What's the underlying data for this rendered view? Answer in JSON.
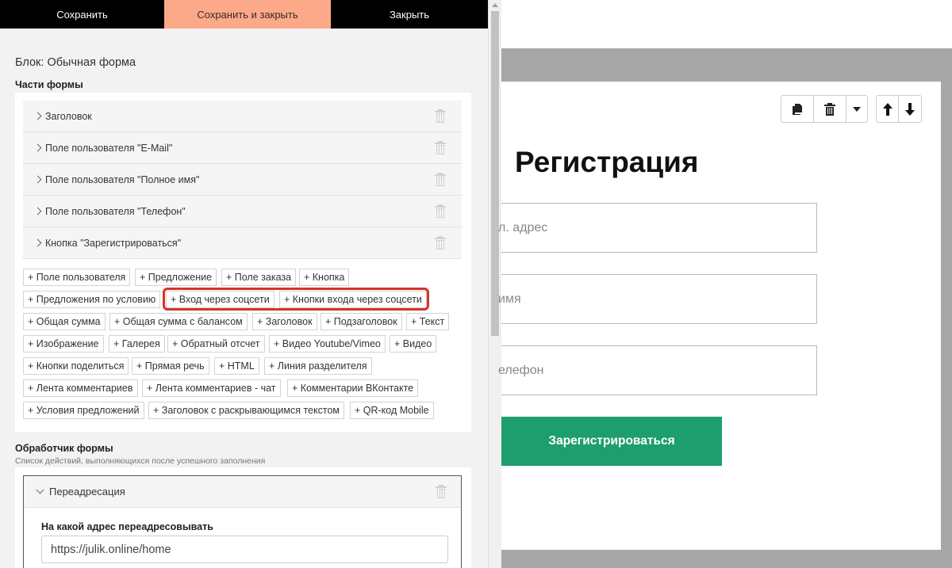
{
  "topbar": {
    "save": "Сохранить",
    "save_close": "Сохранить и закрыть",
    "close": "Закрыть"
  },
  "block_title": "Блок: Обычная форма",
  "parts": {
    "title": "Части формы",
    "rows": [
      "Заголовок",
      "Поле пользователя \"E-Mail\"",
      "Поле пользователя \"Полное имя\"",
      "Поле пользователя \"Телефон\"",
      "Кнопка \"Зарегистрироваться\""
    ],
    "chips": [
      "+ Поле пользователя",
      "+ Предложение",
      "+ Поле заказа",
      "+ Кнопка",
      "+ Предложения по условию",
      "+ Вход через соцсети",
      "+ Кнопки входа через соцсети",
      "+ Общая сумма",
      "+ Общая сумма с балансом",
      "+ Заголовок",
      "+ Подзаголовок",
      "+ Текст",
      "+ Изображение",
      "+ Галерея",
      "+ Обратный отсчет",
      "+ Видео Youtube/Vimeo",
      "+ Видео",
      "+ Кнопки поделиться",
      "+ Прямая речь",
      "+ HTML",
      "+ Линия разделителя",
      "+ Лента комментариев",
      "+ Лента комментариев - чат",
      "+ Комментарии ВКонтакте",
      "+ Условия предложений",
      "+ Заголовок с раскрывающимся текстом",
      "+ QR-код Mobile"
    ]
  },
  "handler": {
    "title": "Обработчик формы",
    "subtitle": "Список действий, выполняющихся после успешного заполнения",
    "action": "Переадресация",
    "redirect_label": "На какой адрес переадресовывать",
    "redirect_value": "https://julik.online/home"
  },
  "preview": {
    "title": "Регистрация",
    "field_email": "л. адрес",
    "field_name": "имя",
    "field_phone": "елефон",
    "button": "Зарегистрироваться",
    "tools": [
      "copy-icon",
      "trash-icon",
      "caret-down-icon",
      "arrow-up-icon",
      "arrow-down-icon"
    ]
  },
  "colors": {
    "accent_button": "#fca98a",
    "register_button": "#1e9e6e",
    "highlight": "#d8332a"
  }
}
